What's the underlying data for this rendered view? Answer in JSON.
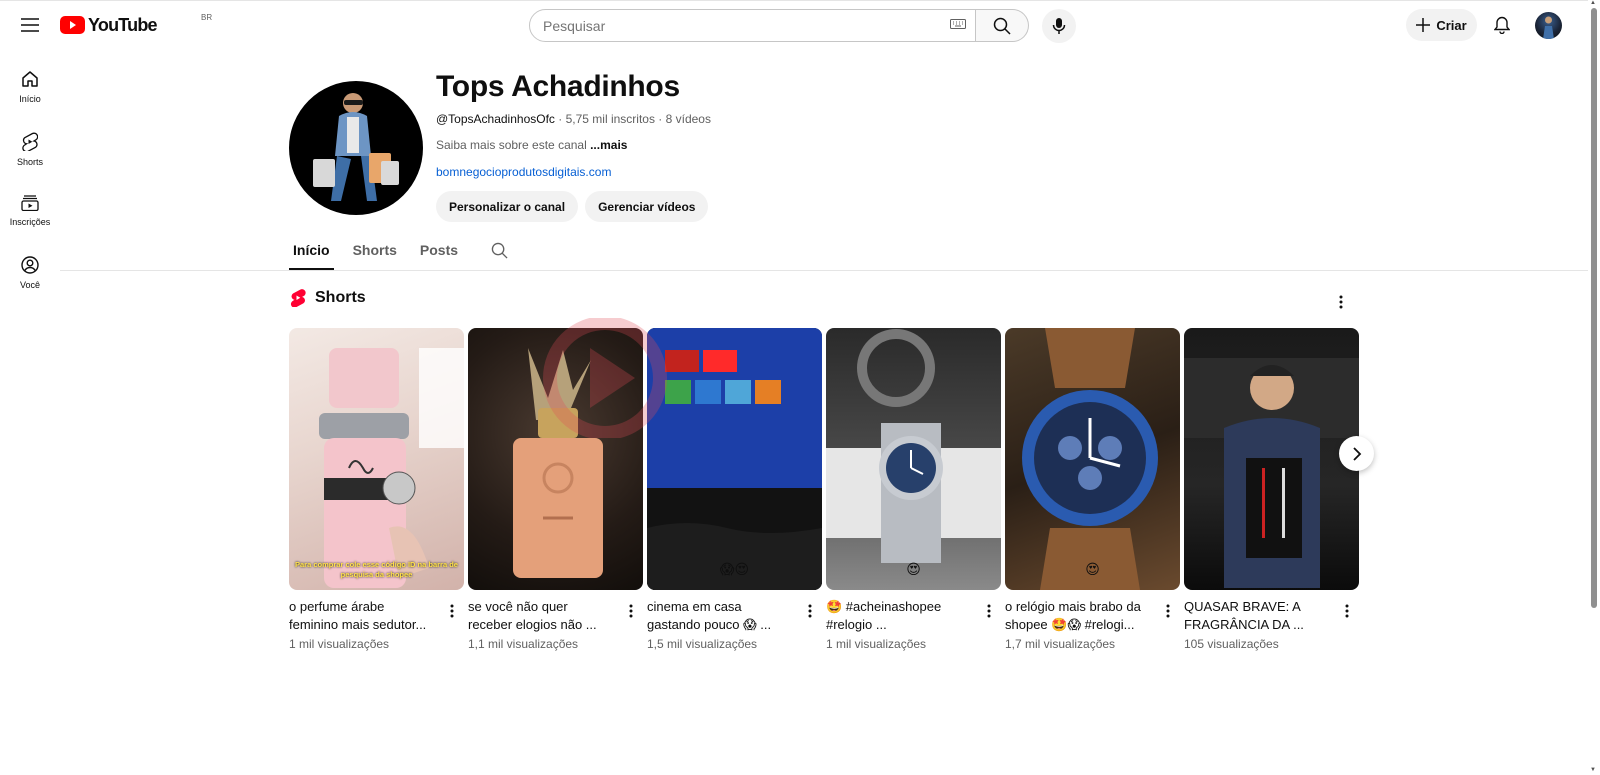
{
  "header": {
    "logo_text": "YouTube",
    "region": "BR",
    "search_placeholder": "Pesquisar",
    "create_label": "Criar"
  },
  "sidebar": {
    "items": [
      {
        "label": "Início",
        "icon": "home-icon"
      },
      {
        "label": "Shorts",
        "icon": "shorts-icon"
      },
      {
        "label": "Inscrições",
        "icon": "subscriptions-icon"
      },
      {
        "label": "Você",
        "icon": "you-icon"
      }
    ]
  },
  "channel": {
    "name": "Tops Achadinhos",
    "handle": "@TopsAchadinhosOfc",
    "subscribers": "· 5,75 mil inscritos · 8 vídeos",
    "description": "Saiba mais sobre este canal ",
    "more": "...mais",
    "link": "bomnegocioprodutosdigitais.com",
    "buttons": {
      "customize": "Personalizar o canal",
      "manage": "Gerenciar vídeos"
    }
  },
  "tabs": [
    "Início",
    "Shorts",
    "Posts"
  ],
  "shorts_shelf": {
    "title": "Shorts",
    "items": [
      {
        "title": "o perfume árabe feminino mais sedutor...",
        "views": "1 mil visualizações",
        "caption": "Para comprar cole esse código ID na barra de pesquisa da shopee"
      },
      {
        "title": "se você  não quer receber elogios não ...",
        "views": "1,1 mil visualizações"
      },
      {
        "title": "cinema em casa gastando pouco 😱 ...",
        "views": "1,5 mil visualizações",
        "emoji": "😱😍"
      },
      {
        "title": "🤩 #acheinashopee #relogio ...",
        "views": "1 mil visualizações",
        "emoji": "😍"
      },
      {
        "title": "o relógio mais brabo da shopee 🤩😱 #relogi...",
        "views": "1,7 mil visualizações",
        "emoji": "😍"
      },
      {
        "title": "QUASAR BRAVE: A FRAGRÂNCIA DA ...",
        "views": "105 visualizações"
      }
    ]
  },
  "colors": {
    "brand_red": "#ff0000",
    "link_blue": "#065fd4",
    "text_secondary": "#606060"
  }
}
